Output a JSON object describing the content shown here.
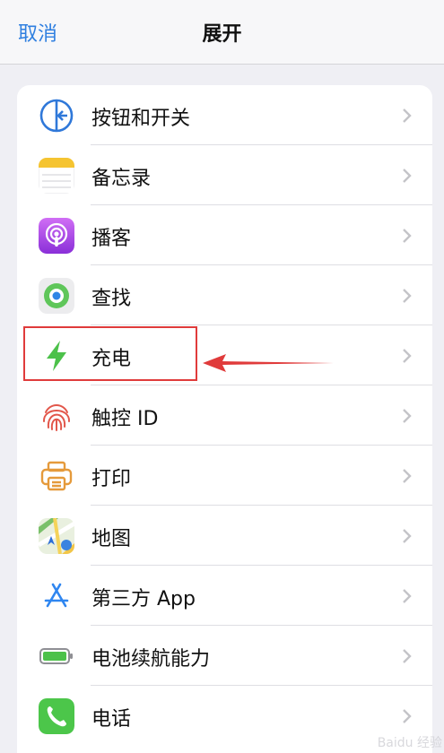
{
  "nav": {
    "cancel_label": "取消",
    "title": "展开"
  },
  "items": [
    {
      "label": "按钮和开关",
      "icon": "switch-control-icon"
    },
    {
      "label": "备忘录",
      "icon": "notes-icon"
    },
    {
      "label": "播客",
      "icon": "podcasts-icon"
    },
    {
      "label": "查找",
      "icon": "find-my-icon"
    },
    {
      "label": "充电",
      "icon": "charging-bolt-icon"
    },
    {
      "label": "触控 ID",
      "icon": "fingerprint-icon"
    },
    {
      "label": "打印",
      "icon": "printer-icon"
    },
    {
      "label": "地图",
      "icon": "maps-icon"
    },
    {
      "label": "第三方 App",
      "icon": "app-store-icon"
    },
    {
      "label": "电池续航能力",
      "icon": "battery-icon"
    },
    {
      "label": "电话",
      "icon": "phone-icon"
    }
  ],
  "annotation": {
    "highlighted_item": "充电",
    "color": "#e03b3b"
  },
  "watermark": "Baidu 经验"
}
